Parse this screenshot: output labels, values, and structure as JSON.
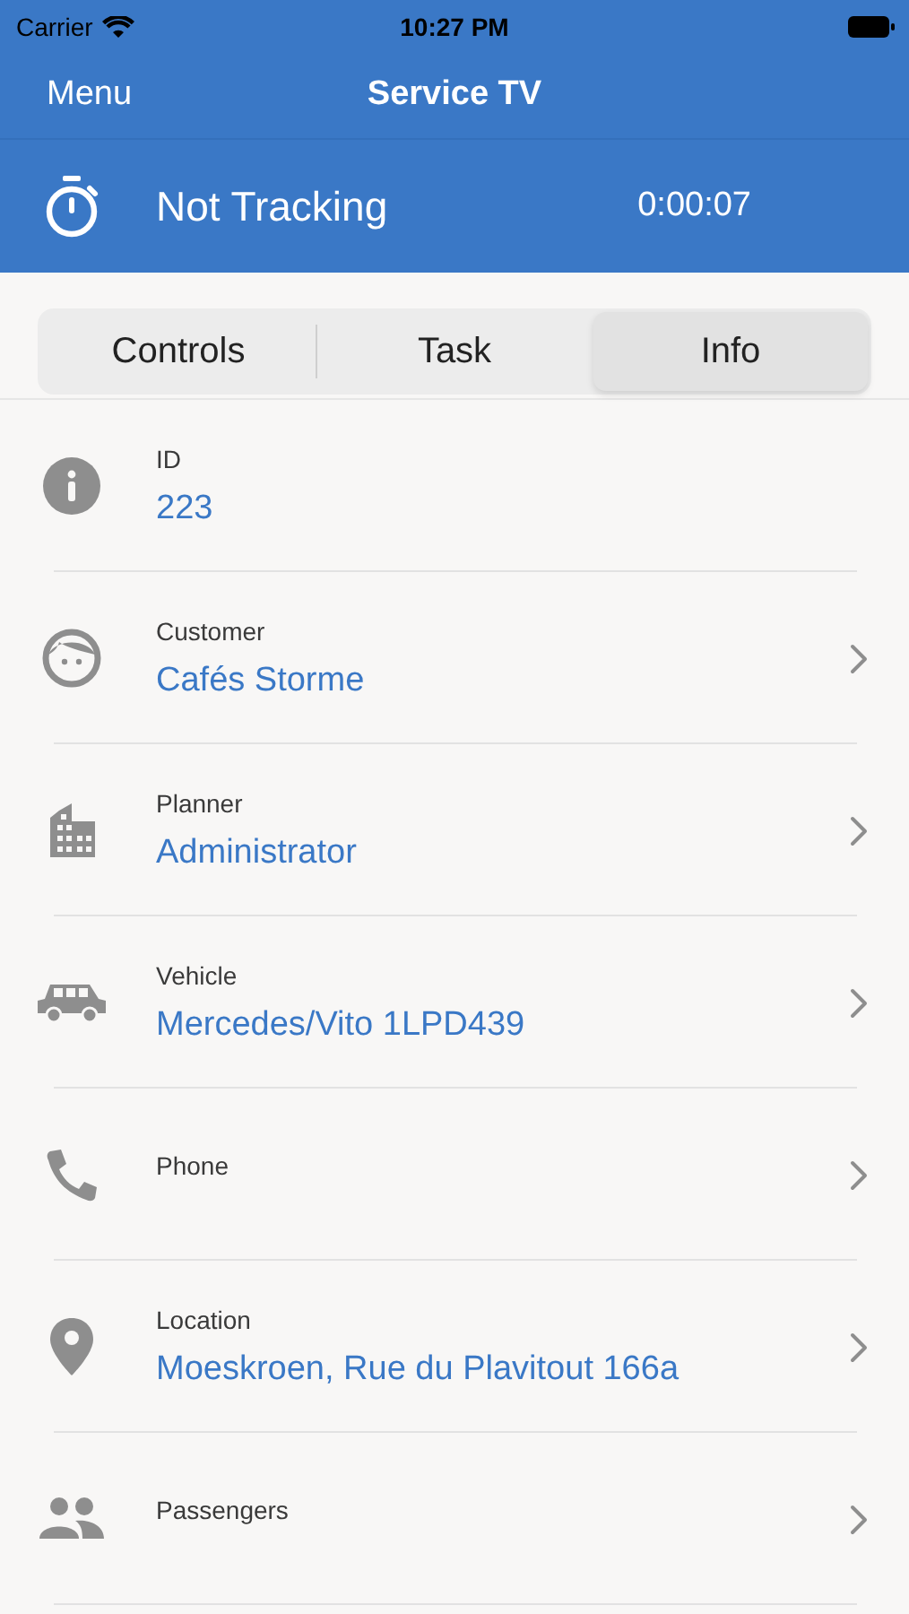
{
  "status_bar": {
    "carrier": "Carrier",
    "time": "10:27 PM"
  },
  "nav": {
    "menu": "Menu",
    "title": "Service TV"
  },
  "tracking": {
    "status": "Not Tracking",
    "elapsed": "0:00:07"
  },
  "tabs": [
    {
      "label": "Controls",
      "selected": false
    },
    {
      "label": "Task",
      "selected": false
    },
    {
      "label": "Info",
      "selected": true
    }
  ],
  "rows": [
    {
      "kind": "info",
      "label": "ID",
      "value": "223",
      "disclosure": false
    },
    {
      "kind": "customer",
      "label": "Customer",
      "value": "Cafés Storme",
      "disclosure": true
    },
    {
      "kind": "planner",
      "label": "Planner",
      "value": "Administrator",
      "disclosure": true
    },
    {
      "kind": "vehicle",
      "label": "Vehicle",
      "value": "Mercedes/Vito 1LPD439",
      "disclosure": true
    },
    {
      "kind": "phone",
      "label": "Phone",
      "disclosure": true
    },
    {
      "kind": "location",
      "label": "Location",
      "value": "Moeskroen, Rue du Plavitout 166a",
      "disclosure": true
    },
    {
      "kind": "passengers",
      "label": "Passengers",
      "disclosure": true
    }
  ]
}
